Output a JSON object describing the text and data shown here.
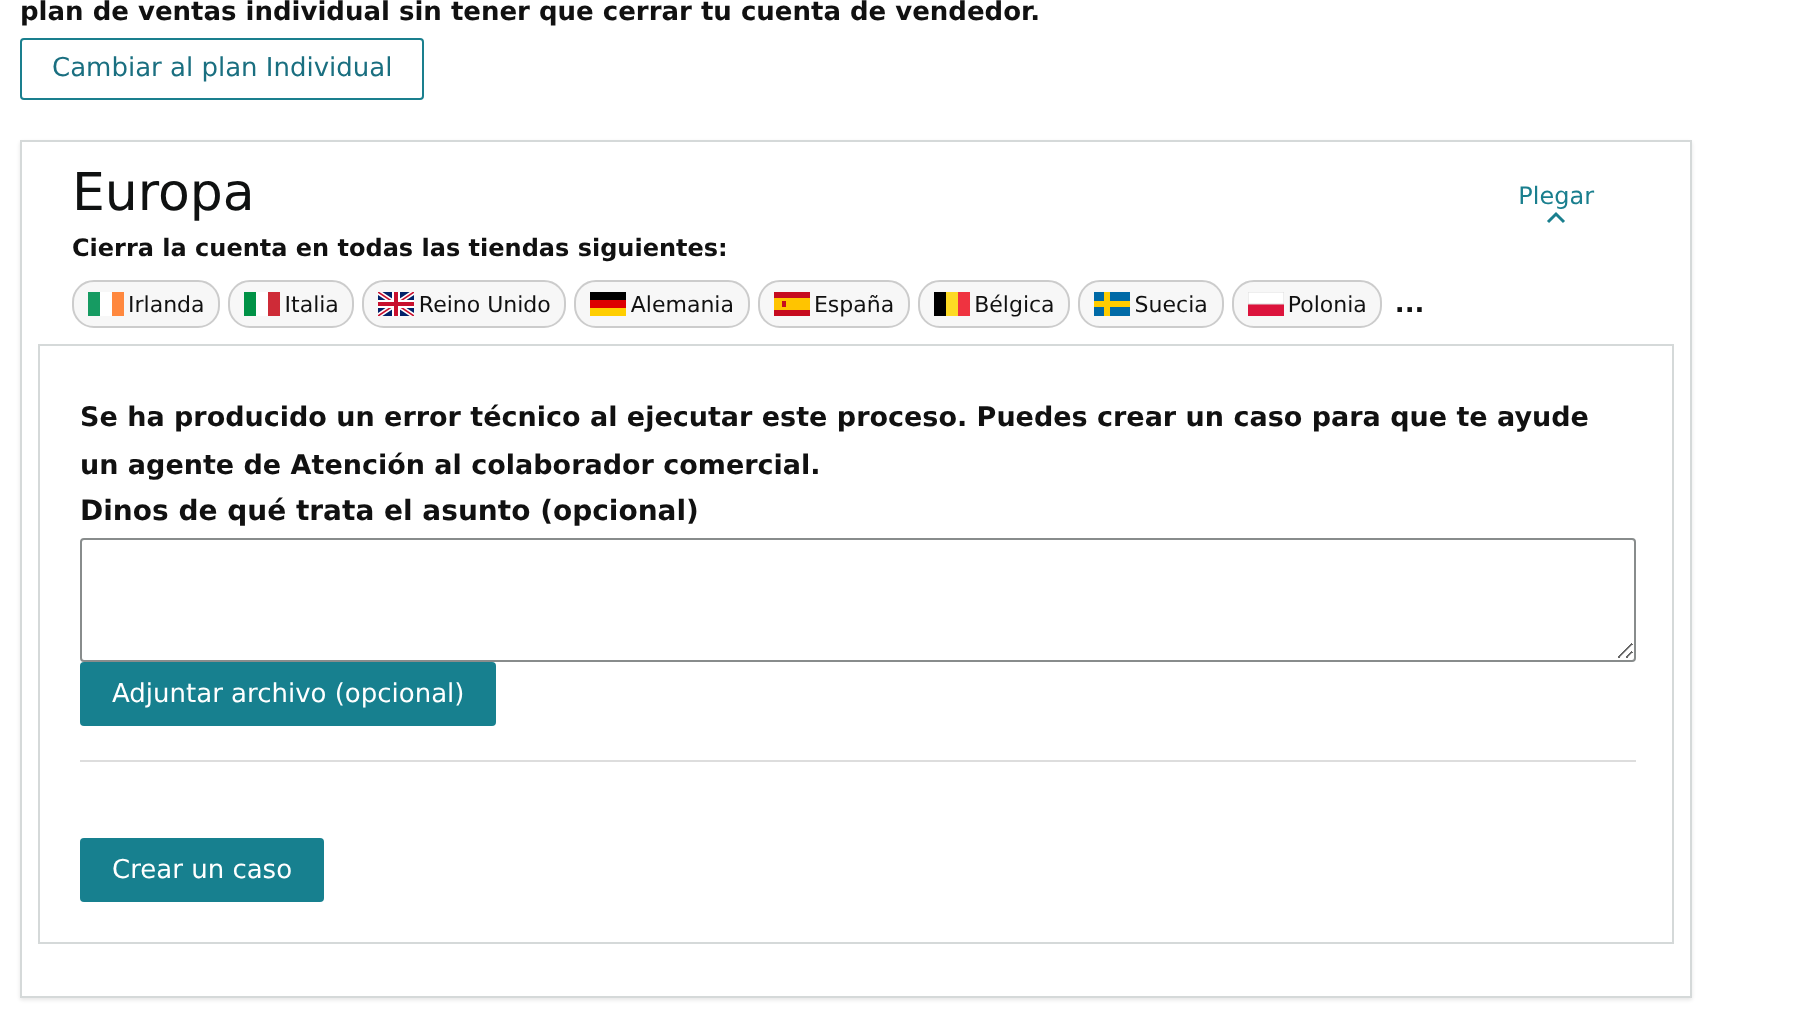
{
  "intro_text": "plan de ventas individual sin tener que cerrar tu cuenta de vendedor.",
  "switch_button": "Cambiar al plan Individual",
  "region": {
    "title": "Europa",
    "collapse_link": "Plegar",
    "subtitle": "Cierra la cuenta en todas las tiendas siguientes:",
    "stores": [
      {
        "label": "Irlanda",
        "kind": "ie"
      },
      {
        "label": "Italia",
        "kind": "it"
      },
      {
        "label": "Reino Unido",
        "kind": "uk"
      },
      {
        "label": "Alemania",
        "kind": "de"
      },
      {
        "label": "España",
        "kind": "es"
      },
      {
        "label": "Bélgica",
        "kind": "be"
      },
      {
        "label": "Suecia",
        "kind": "se"
      },
      {
        "label": "Polonia",
        "kind": "pl"
      }
    ],
    "more": "..."
  },
  "error_box": {
    "message": "Se ha producido un error técnico al ejecutar este proceso. Puedes crear un caso para que te ayude un agente de Atención al colaborador comercial.",
    "field_label": "Dinos de qué trata el asunto (opcional)",
    "attach_button": "Adjuntar archivo (opcional)",
    "create_button": "Crear un caso"
  }
}
